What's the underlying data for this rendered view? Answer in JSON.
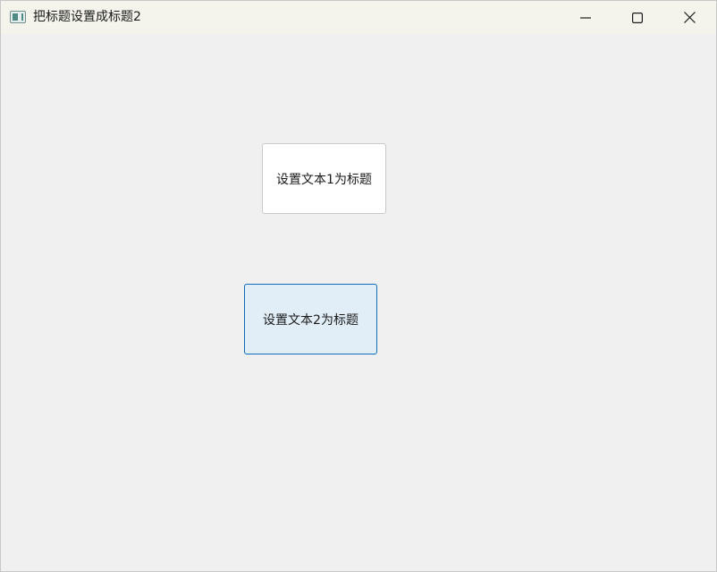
{
  "window": {
    "title": "把标题设置成标题2",
    "controls": {
      "minimize_icon": "minimize-icon",
      "maximize_icon": "maximize-icon",
      "close_icon": "close-icon"
    }
  },
  "buttons": {
    "set_text1": "设置文本1为标题",
    "set_text2": "设置文本2为标题"
  },
  "colors": {
    "focus_border": "#0f6cbd",
    "focus_fill": "#e1eef8",
    "background": "#f0f0f0"
  }
}
